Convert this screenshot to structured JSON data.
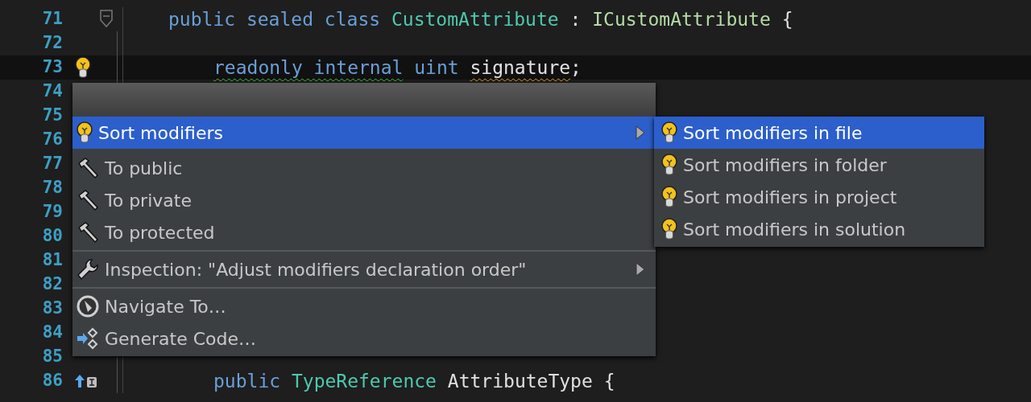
{
  "editor": {
    "lines": [
      {
        "number": "71",
        "kind": "fold",
        "current": false,
        "code": [
          {
            "text": "public sealed class",
            "kind": "keyword"
          },
          {
            "text": "CustomAttribute",
            "kind": "type"
          },
          {
            "text": ":",
            "kind": "plain"
          },
          {
            "text": "ICustomAttribute",
            "kind": "interface"
          },
          {
            "text": "{",
            "kind": "plain"
          }
        ],
        "children": [
          {
            "number": "72",
            "current": false
          },
          {
            "number": "73",
            "kind": "bulb",
            "current": true,
            "code": [
              {
                "text": "readonly internal",
                "kind": "keyword",
                "suggestion": true,
                "warning": false
              },
              {
                "text": "uint",
                "kind": "keyword",
                "suggestion": false,
                "warning": false
              },
              {
                "text": "signature",
                "kind": "plain",
                "suggestion": false,
                "warning": true
              },
              {
                "text": ";",
                "kind": "plain",
                "attached": true,
                "suggestion": false,
                "warning": false
              }
            ]
          },
          {
            "number": "74",
            "current": false
          },
          {
            "number": "75",
            "current": false
          },
          {
            "number": "76",
            "current": false
          },
          {
            "number": "77",
            "current": false
          },
          {
            "number": "78",
            "current": false
          },
          {
            "number": "79",
            "current": false
          },
          {
            "number": "80",
            "current": false
          },
          {
            "number": "81",
            "current": false
          },
          {
            "number": "82",
            "current": false
          },
          {
            "number": "83",
            "current": false
          },
          {
            "number": "84",
            "current": false
          },
          {
            "number": "85",
            "current": false
          },
          {
            "number": "86",
            "kind": "implements",
            "current": false,
            "code": [
              {
                "text": "public",
                "kind": "keyword"
              },
              {
                "text": "TypeReference",
                "kind": "type"
              },
              {
                "text": "AttributeType",
                "kind": "plain"
              },
              {
                "text": "{",
                "kind": "plain"
              }
            ]
          }
        ]
      }
    ]
  },
  "menu": {
    "sections": [
      [
        {
          "label": "Sort modifiers",
          "kind": "bulb",
          "selected": true,
          "submenu": true
        }
      ],
      [
        {
          "label": "To public",
          "kind": "hammer",
          "selected": false,
          "submenu": false
        },
        {
          "label": "To private",
          "kind": "hammer",
          "selected": false,
          "submenu": false
        },
        {
          "label": "To protected",
          "kind": "hammer",
          "selected": false,
          "submenu": false
        }
      ],
      [
        {
          "label": "Inspection: \"Adjust modifiers declaration order\"",
          "kind": "wrench",
          "selected": false,
          "submenu": true
        }
      ],
      [
        {
          "label": "Navigate To…",
          "kind": "compass",
          "selected": false,
          "submenu": false
        },
        {
          "label": "Generate Code…",
          "kind": "generate",
          "selected": false,
          "submenu": false
        }
      ]
    ]
  },
  "submenu": {
    "items": [
      {
        "label": "Sort modifiers in file",
        "kind": "bulb",
        "selected": true
      },
      {
        "label": "Sort modifiers in folder",
        "kind": "bulb",
        "selected": false
      },
      {
        "label": "Sort modifiers in project",
        "kind": "bulb",
        "selected": false
      },
      {
        "label": "Sort modifiers in solution",
        "kind": "bulb",
        "selected": false
      }
    ]
  }
}
